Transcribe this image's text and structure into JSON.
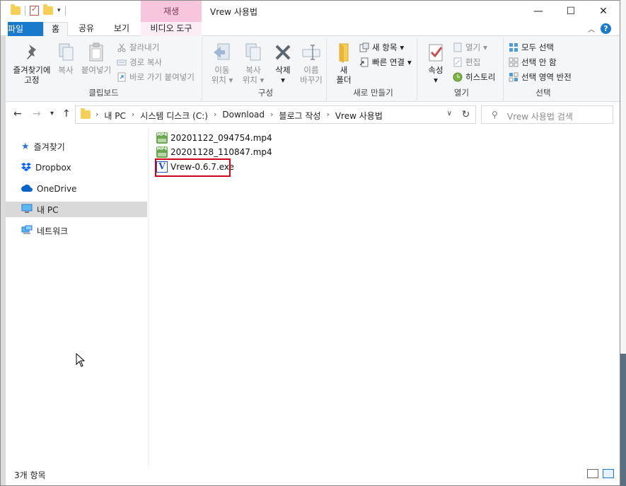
{
  "window": {
    "title": "Vrew 사용법",
    "context_tab_group": "재생",
    "controls": {
      "minimize": "—",
      "maximize": "☐",
      "close": "✕"
    }
  },
  "ribbon_tabs": [
    {
      "label": "파일"
    },
    {
      "label": "홈"
    },
    {
      "label": "공유"
    },
    {
      "label": "보기"
    },
    {
      "label": "비디오 도구"
    }
  ],
  "ribbon": {
    "clipboard": {
      "label": "클립보드",
      "pin_label_1": "즐겨찾기에",
      "pin_label_2": "고정",
      "copy": "복사",
      "paste": "붙여넣기",
      "cut": "잘라내기",
      "copy_path": "경로 복사",
      "paste_shortcut": "바로 가기 붙여넣기"
    },
    "organize": {
      "label": "구성",
      "move_1": "이동",
      "move_2": "위치",
      "copy_1": "복사",
      "copy_2": "위치",
      "delete": "삭제",
      "rename_1": "이름",
      "rename_2": "바꾸기"
    },
    "new": {
      "label": "새로 만들기",
      "new_folder_1": "새",
      "new_folder_2": "폴더",
      "new_item": "새 항목",
      "easy_access": "빠른 연결"
    },
    "open": {
      "label": "열기",
      "properties": "속성",
      "open": "열기",
      "edit": "편집",
      "history": "히스토리"
    },
    "select": {
      "label": "선택",
      "select_all": "모두 선택",
      "select_none": "선택 안 함",
      "invert": "선택 영역 반전"
    }
  },
  "address": {
    "breadcrumbs": [
      "내 PC",
      "시스템 디스크 (C:)",
      "Download",
      "블로그 작성",
      "Vrew 사용법"
    ],
    "search_placeholder": "Vrew 사용법 검색"
  },
  "nav_pane": [
    {
      "label": "즐겨찾기",
      "icon": "star-icon",
      "selected": false
    },
    {
      "label": "Dropbox",
      "icon": "dropbox-icon",
      "selected": false
    },
    {
      "label": "OneDrive",
      "icon": "cloud-icon",
      "selected": false
    },
    {
      "label": "내 PC",
      "icon": "computer-icon",
      "selected": true
    },
    {
      "label": "네트워크",
      "icon": "network-icon",
      "selected": false
    }
  ],
  "files": [
    {
      "name": "20201122_094754.mp4",
      "type": "mp4"
    },
    {
      "name": "20201128_110847.mp4",
      "type": "mp4"
    },
    {
      "name": "Vrew-0.6.7.exe",
      "type": "exe"
    }
  ],
  "status": {
    "item_count": "3개 항목"
  },
  "colors": {
    "accent": "#1979ca",
    "context_tab": "#f7c6dc",
    "highlight": "#d0021b",
    "folder": "#f6cf57"
  }
}
